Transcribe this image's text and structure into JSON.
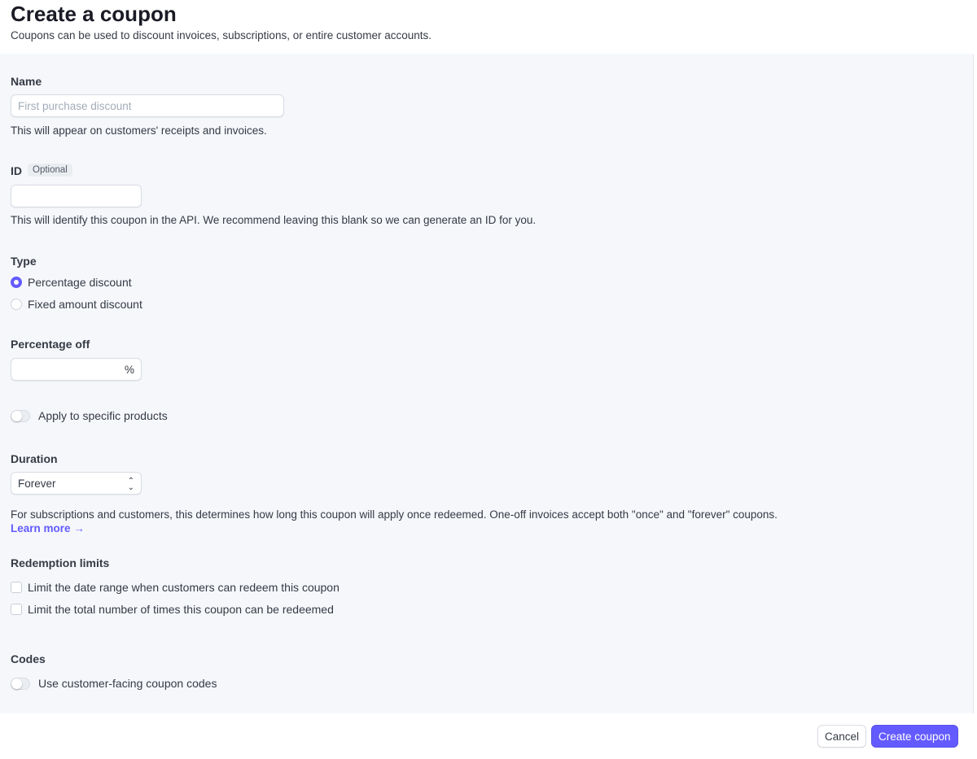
{
  "header": {
    "title": "Create a coupon",
    "subtitle": "Coupons can be used to discount invoices, subscriptions, or entire customer accounts."
  },
  "name": {
    "label": "Name",
    "placeholder": "First purchase discount",
    "value": "",
    "help": "This will appear on customers' receipts and invoices."
  },
  "id": {
    "label": "ID",
    "badge": "Optional",
    "value": "",
    "help": "This will identify this coupon in the API. We recommend leaving this blank so we can generate an ID for you."
  },
  "type": {
    "label": "Type",
    "options": [
      {
        "label": "Percentage discount",
        "selected": true
      },
      {
        "label": "Fixed amount discount",
        "selected": false
      }
    ]
  },
  "percentage": {
    "label": "Percentage off",
    "value": "",
    "suffix": "%"
  },
  "apply_products": {
    "label": "Apply to specific products",
    "on": false
  },
  "duration": {
    "label": "Duration",
    "selected": "Forever",
    "help": "For subscriptions and customers, this determines how long this coupon will apply once redeemed. One-off invoices accept both \"once\" and \"forever\" coupons.",
    "learn_more": "Learn more →"
  },
  "redemption": {
    "label": "Redemption limits",
    "options": [
      {
        "label": "Limit the date range when customers can redeem this coupon",
        "checked": false
      },
      {
        "label": "Limit the total number of times this coupon can be redeemed",
        "checked": false
      }
    ]
  },
  "codes": {
    "label": "Codes",
    "toggle_label": "Use customer-facing coupon codes",
    "on": false
  },
  "footer": {
    "cancel": "Cancel",
    "create": "Create coupon"
  },
  "colors": {
    "accent": "#635bff",
    "background": "#f5f7fb"
  }
}
